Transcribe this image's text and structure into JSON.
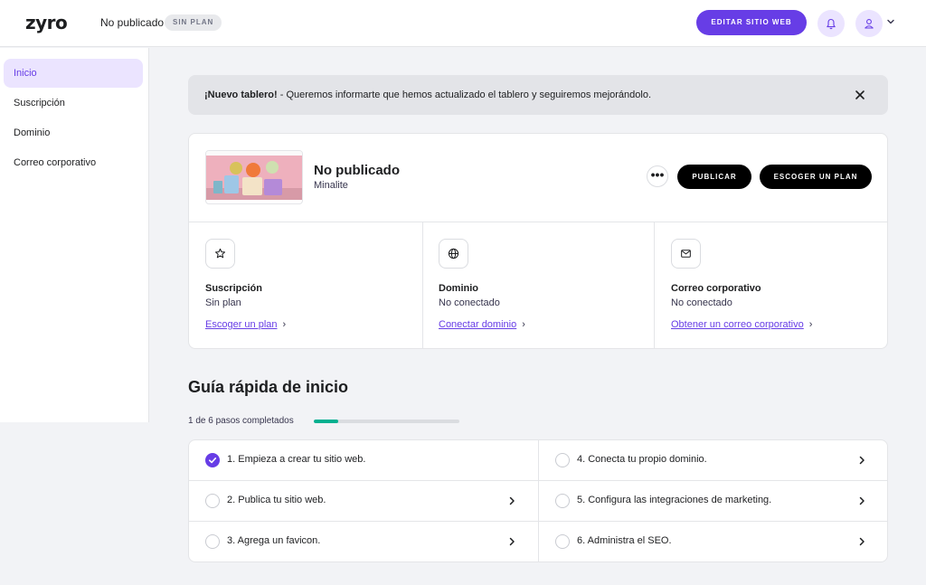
{
  "header": {
    "logo": "zyro",
    "site_status": "No publicado",
    "plan_badge": "SIN PLAN",
    "edit_button": "EDITAR SITIO WEB"
  },
  "sidebar": {
    "items": [
      {
        "label": "Inicio",
        "active": true
      },
      {
        "label": "Suscripción",
        "active": false
      },
      {
        "label": "Dominio",
        "active": false
      },
      {
        "label": "Correo corporativo",
        "active": false
      }
    ]
  },
  "banner": {
    "bold": "¡Nuevo tablero!",
    "text": " - Queremos informarte que hemos actualizado el tablero y seguiremos mejorándolo."
  },
  "site": {
    "title": "No publicado",
    "subtitle": "Minalite",
    "more": "•••",
    "publish_button": "PUBLICAR",
    "plan_button": "ESCOGER UN PLAN"
  },
  "features": [
    {
      "title": "Suscripción",
      "status": "Sin plan",
      "link": "Escoger un plan",
      "icon": "star-icon"
    },
    {
      "title": "Dominio",
      "status": "No conectado",
      "link": "Conectar dominio",
      "icon": "globe-icon"
    },
    {
      "title": "Correo corporativo",
      "status": "No conectado",
      "link": "Obtener un correo corporativo",
      "icon": "mail-icon"
    }
  ],
  "guide": {
    "title": "Guía rápida de inicio",
    "progress_text": "1 de 6 pasos completados",
    "progress_fraction": 0.17,
    "steps": [
      {
        "label": "1. Empieza a crear tu sitio web.",
        "done": true
      },
      {
        "label": "2. Publica tu sitio web.",
        "done": false
      },
      {
        "label": "3. Agrega un favicon.",
        "done": false
      },
      {
        "label": "4. Conecta tu propio dominio.",
        "done": false
      },
      {
        "label": "5. Configura las integraciones de marketing.",
        "done": false
      },
      {
        "label": "6. Administra el SEO.",
        "done": false
      }
    ]
  },
  "colors": {
    "accent": "#673de6",
    "accent_light": "#ebe4ff",
    "progress": "#00b090"
  }
}
